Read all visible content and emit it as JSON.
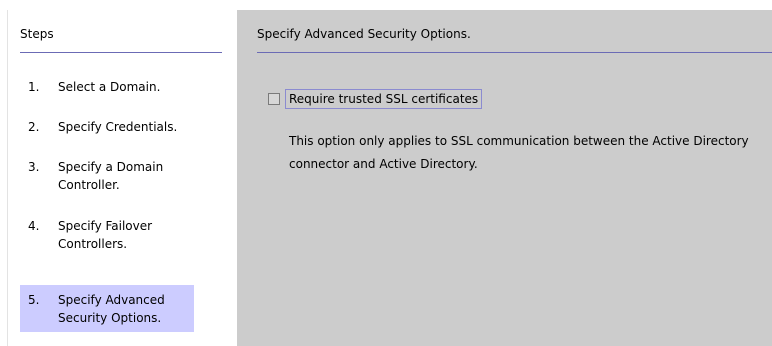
{
  "steps": {
    "header": "Steps",
    "items": [
      {
        "number": "1.",
        "label": "Select a Domain."
      },
      {
        "number": "2.",
        "label": "Specify Credentials."
      },
      {
        "number": "3.",
        "label": "Specify a Domain Controller."
      },
      {
        "number": "4.",
        "label": "Specify Failover Controllers."
      },
      {
        "number": "5.",
        "label": "Specify Advanced Security Options."
      }
    ],
    "current_step": 5
  },
  "main": {
    "title": "Specify Advanced Security Options.",
    "checkbox": {
      "label": "Require trusted SSL certificates",
      "checked": false
    },
    "help_text": "This option only applies to SSL communication between the Active Directory connector and Active Directory."
  },
  "colors": {
    "main_background": "#cccccc",
    "current_step_highlight": "#ccccff",
    "divider": "#6b6bb5"
  }
}
